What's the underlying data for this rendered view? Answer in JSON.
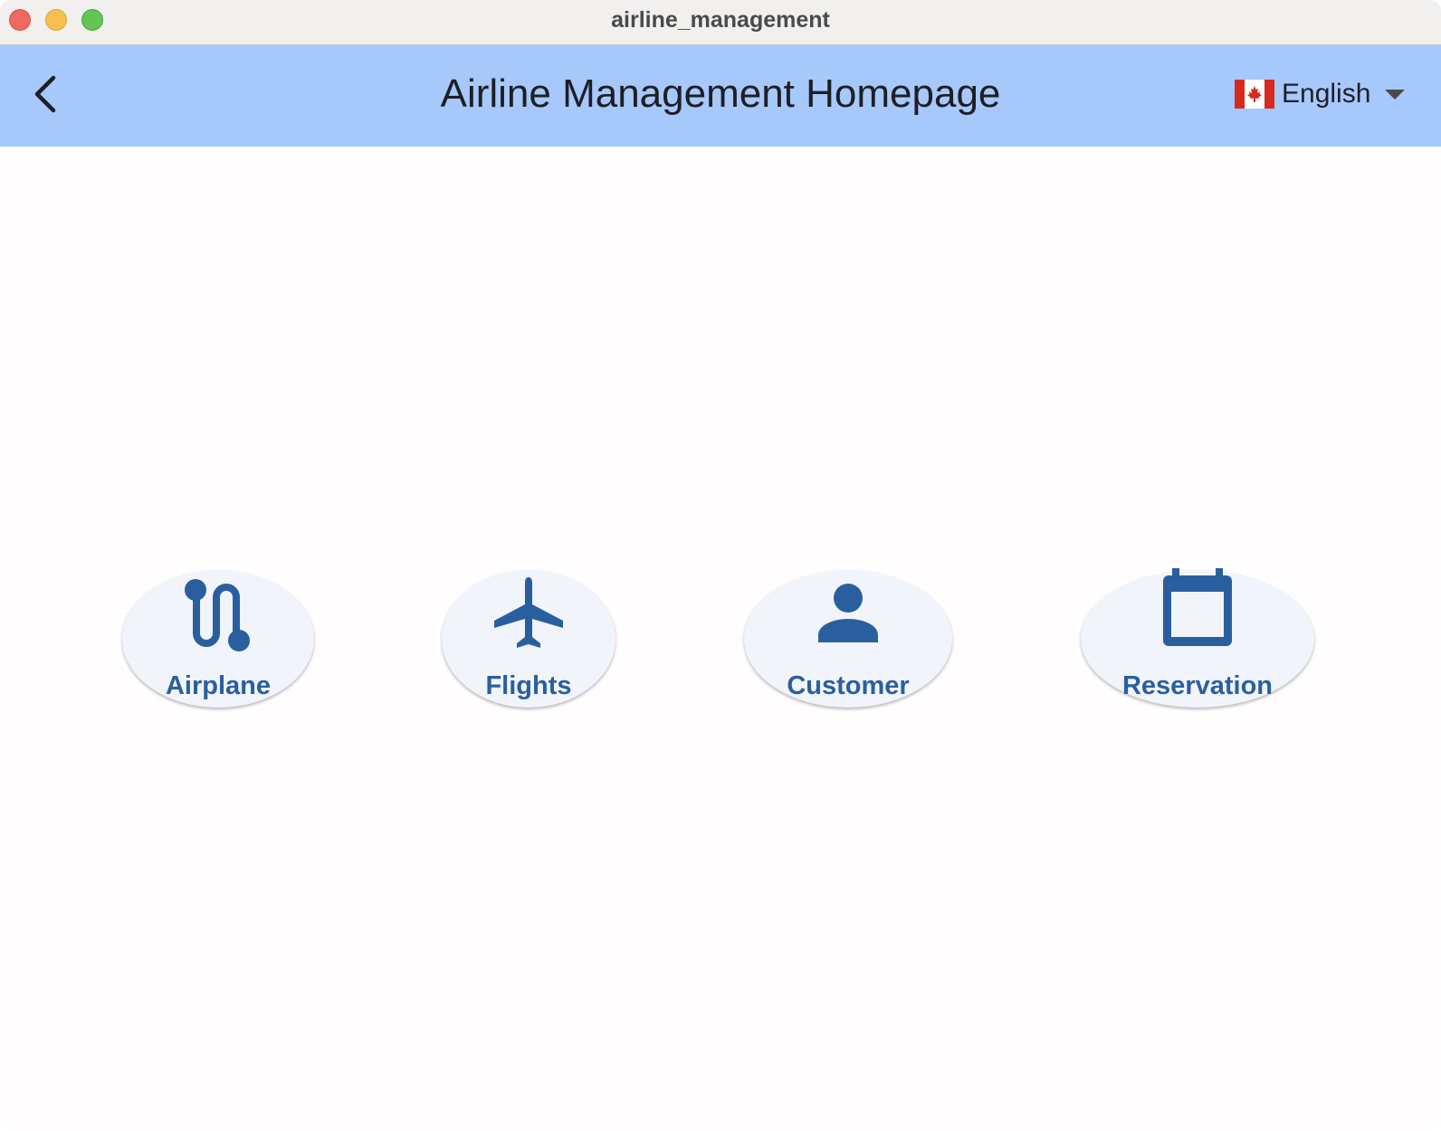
{
  "window": {
    "title": "airline_management"
  },
  "appbar": {
    "title": "Airline Management Homepage",
    "language": {
      "selected": "English",
      "flag": "canada-flag-icon"
    },
    "background_color": "#a7c8fb"
  },
  "nav": {
    "accent_color": "#2a5f9f",
    "pill_color": "#f1f4fa",
    "items": [
      {
        "label": "Airplane",
        "icon": "route-icon"
      },
      {
        "label": "Flights",
        "icon": "airplane-icon"
      },
      {
        "label": "Customer",
        "icon": "person-icon"
      },
      {
        "label": "Reservation",
        "icon": "calendar-icon"
      }
    ]
  }
}
